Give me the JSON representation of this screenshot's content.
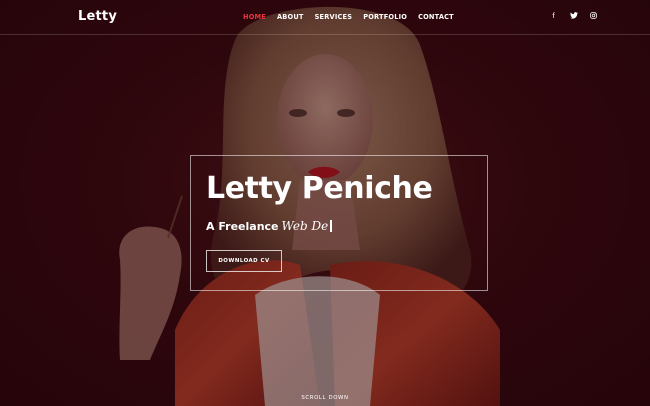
{
  "brand": {
    "logo": "Letty"
  },
  "nav": {
    "items": [
      {
        "label": "HOME",
        "active": true
      },
      {
        "label": "ABOUT",
        "active": false
      },
      {
        "label": "SERVICES",
        "active": false
      },
      {
        "label": "PORTFOLIO",
        "active": false
      },
      {
        "label": "CONTACT",
        "active": false
      }
    ]
  },
  "social": {
    "items": [
      {
        "icon": "facebook-icon",
        "glyph": "f"
      },
      {
        "icon": "twitter-icon",
        "glyph": ""
      },
      {
        "icon": "instagram-icon",
        "glyph": ""
      }
    ]
  },
  "hero": {
    "title": "Letty Peniche",
    "tagline_static": "A Freelance",
    "tagline_typed": "Web De",
    "cta_label": "DOWNLOAD CV",
    "scroll_label": "SCROLL DOWN"
  },
  "colors": {
    "accent": "#e8353d",
    "background": "#2a070d",
    "overlay": "#28040a"
  }
}
